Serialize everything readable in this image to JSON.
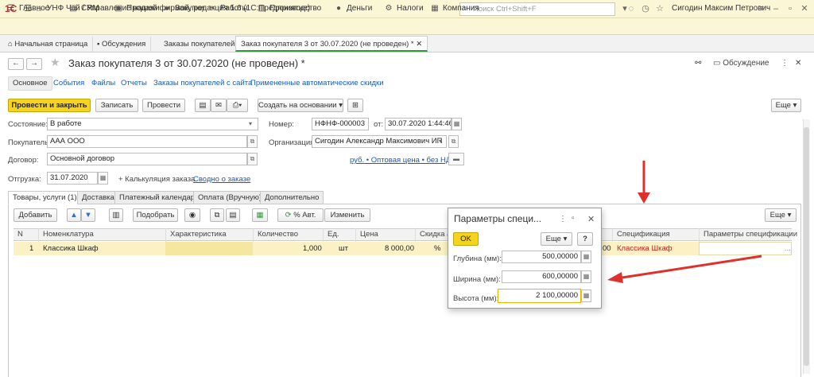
{
  "app": {
    "title": "УНФ Чай / Управление нашей фирмой, редакция 1.6  (1С:Предприятие)",
    "search_placeholder": "Поиск Ctrl+Shift+F",
    "user": "Сигодин Максим Петрович",
    "logo": "1С"
  },
  "menu": [
    {
      "icon": "menu-icon",
      "label": "Главное"
    },
    {
      "icon": "crm-icon",
      "label": "CRM"
    },
    {
      "icon": "cart-icon",
      "label": "Продажи"
    },
    {
      "icon": "truck-icon",
      "label": "Закупки"
    },
    {
      "icon": "tools-icon",
      "label": "Работы"
    },
    {
      "icon": "factory-icon",
      "label": "Производство"
    },
    {
      "icon": "money-icon",
      "label": "Деньги"
    },
    {
      "icon": "tax-icon",
      "label": "Налоги"
    },
    {
      "icon": "company-icon",
      "label": "Компания"
    }
  ],
  "open_tabs": [
    {
      "label": "Начальная страница"
    },
    {
      "label": "Обсуждения"
    },
    {
      "label": "Заказы покупателей"
    },
    {
      "label": "Заказ покупателя 3 от 30.07.2020 (не проведен) *"
    }
  ],
  "doc": {
    "title": "Заказ покупателя 3 от 30.07.2020 (не проведен) *",
    "discussion": "Обсуждение"
  },
  "sections": [
    "Основное",
    "События",
    "Файлы",
    "Отчеты",
    "Заказы покупателей с сайта",
    "Примененные автоматические скидки"
  ],
  "toolbar": {
    "post_close": "Провести и закрыть",
    "save": "Записать",
    "post": "Провести",
    "create_based": "Создать на основании",
    "more": "Еще"
  },
  "form": {
    "state_label": "Состояние:",
    "state_value": "В работе",
    "buyer_label": "Покупатель:",
    "buyer_value": "ААА ООО",
    "contract_label": "Договор:",
    "contract_value": "Основной договор",
    "ship_label": "Отгрузка:",
    "ship_value": "31.07.2020",
    "calc_link": "+ Калькуляция заказа",
    "summary_link": "Сводно о заказе",
    "number_label": "Номер:",
    "number_value": "НФНФ-000003",
    "from_label": "от:",
    "date_value": "30.07.2020  1:44:46",
    "org_label": "Организация:",
    "org_value": "Сигодин Александр Максимович ИП",
    "price_link": "руб. • Оптовая цена • без НДС"
  },
  "doc_tabs": [
    "Товары, услуги (1)",
    "Доставка",
    "Платежный календарь",
    "Оплата (Вручную)",
    "Дополнительно"
  ],
  "table_toolbar": {
    "add": "Добавить",
    "pick": "Подобрать",
    "auto_pct": "% Авт.",
    "change": "Изменить",
    "more": "Еще"
  },
  "table": {
    "columns": [
      "N",
      "Номенклатура",
      "Характеристика",
      "Количество",
      "Ед.",
      "Цена",
      "Скидка а",
      "Спецификация",
      "Параметры спецификации"
    ],
    "rows": [
      {
        "n": "1",
        "item": "Классика Шкаф",
        "char": "",
        "qty": "1,000",
        "unit": "шт",
        "price": "8 000,00",
        "disc": "%",
        "price2": "00",
        "spec": "Классика Шкаф",
        "params": "..."
      }
    ]
  },
  "dialog": {
    "title": "Параметры специ...",
    "ok": "OK",
    "more": "Еще",
    "help": "?",
    "fields": [
      {
        "label": "Глубина (мм):",
        "value": "500,00000"
      },
      {
        "label": "Ширина (мм):",
        "value": "600,00000"
      },
      {
        "label": "Высота (мм):",
        "value": "2 100,00000"
      }
    ]
  },
  "colors": {
    "accent_yellow": "#f6d41e",
    "titlebar": "#fbf6d6",
    "link": "#1a5bb5",
    "red_text": "#c81e1e",
    "arrow_red": "#e0302c"
  }
}
